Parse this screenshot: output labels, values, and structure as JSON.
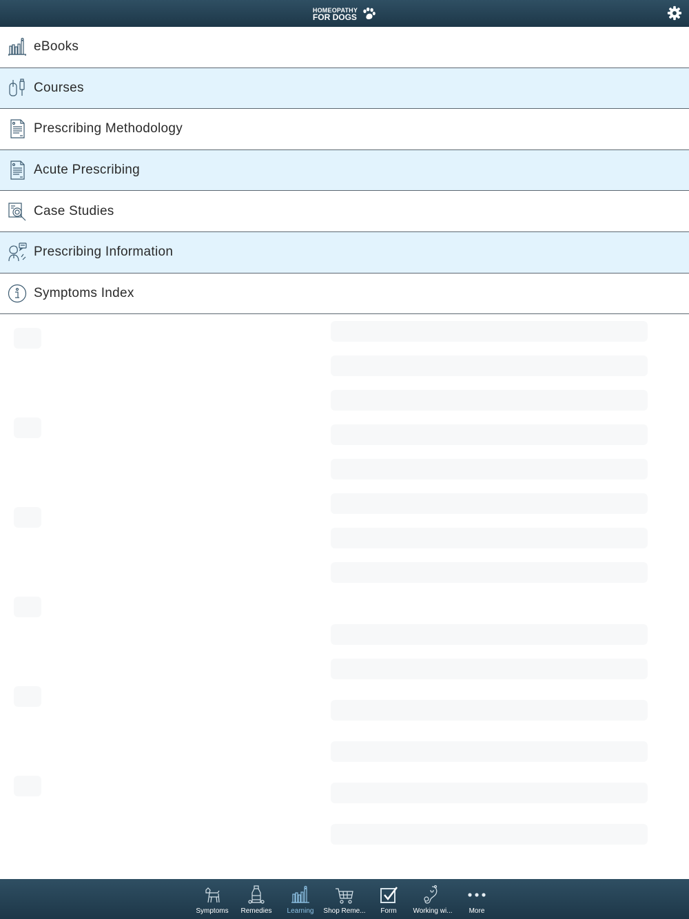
{
  "header": {
    "logo_line1": "HOMEOPATHY",
    "logo_line2": "FOR DOGS",
    "settings_icon": "gear-icon"
  },
  "colors": {
    "bar_bg": "#1d3748",
    "alt_row_bg": "#e2f3fd",
    "icon_stroke": "#3b5a70",
    "active_tab": "#8fc3e6"
  },
  "menu": {
    "items": [
      {
        "label": "eBooks",
        "icon": "bookshelf-icon"
      },
      {
        "label": "Courses",
        "icon": "mouse-usb-icon"
      },
      {
        "label": "Prescribing Methodology",
        "icon": "document-icon"
      },
      {
        "label": "Acute Prescribing",
        "icon": "document-icon"
      },
      {
        "label": "Case Studies",
        "icon": "case-search-icon"
      },
      {
        "label": "Prescribing Information",
        "icon": "vet-speech-icon"
      },
      {
        "label": "Symptoms Index",
        "icon": "info-icon"
      }
    ]
  },
  "tabs": {
    "active": "Learning",
    "items": [
      {
        "label": "Symptoms",
        "icon": "dog-icon"
      },
      {
        "label": "Remedies",
        "icon": "remedy-bottle-icon"
      },
      {
        "label": "Learning",
        "icon": "bookshelf-icon"
      },
      {
        "label": "Shop Reme...",
        "icon": "cart-icon"
      },
      {
        "label": "Form",
        "icon": "checkbox-icon"
      },
      {
        "label": "Working wi...",
        "icon": "stethoscope-icon"
      },
      {
        "label": "More",
        "icon": "more-dots-icon"
      }
    ]
  }
}
